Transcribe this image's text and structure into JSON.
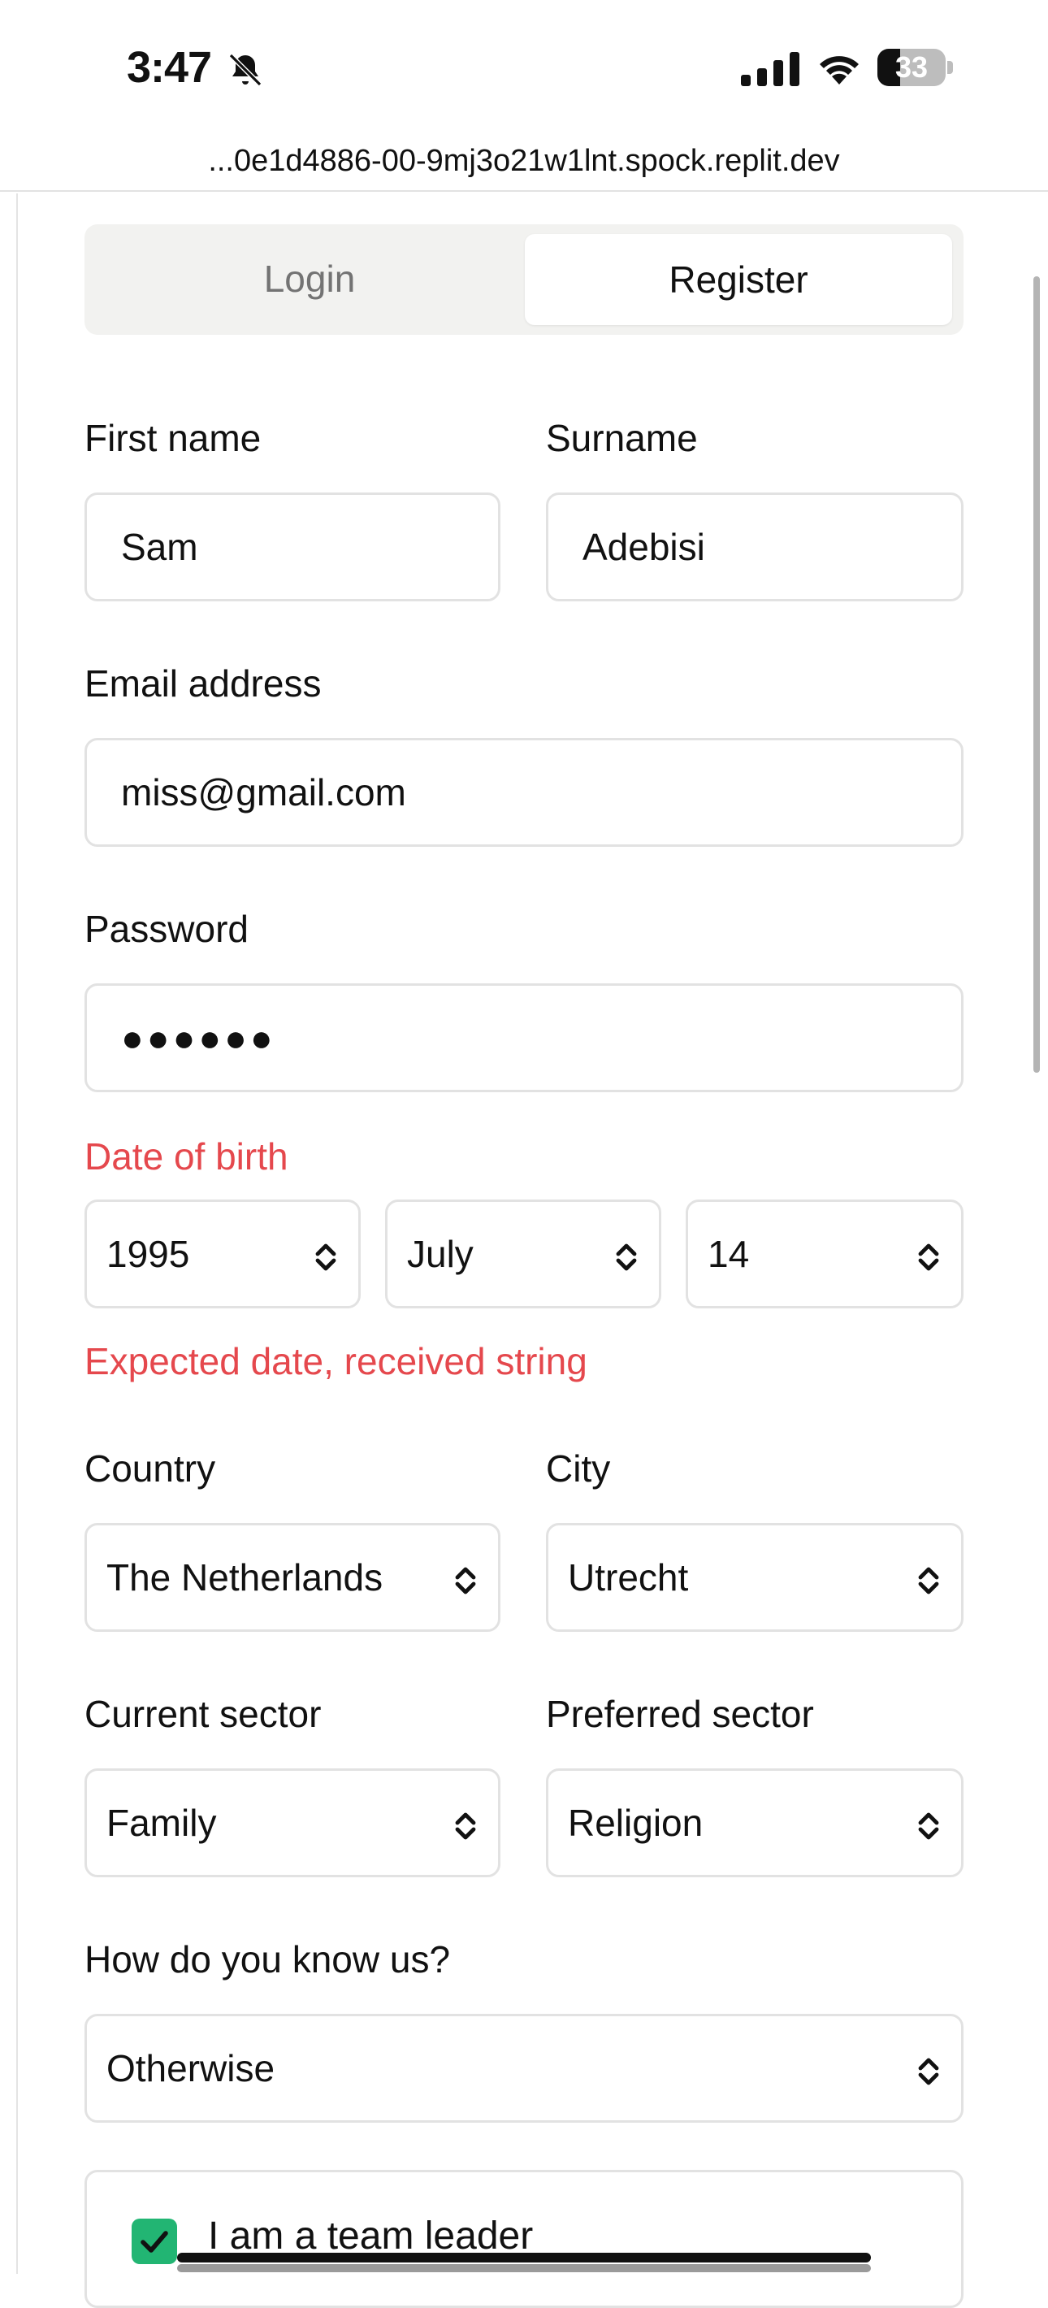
{
  "status_bar": {
    "time": "3:47",
    "battery": "33",
    "battery_level": 0.33,
    "icons": [
      "bell-slash-icon",
      "cellular-signal-icon",
      "wifi-icon",
      "battery-icon"
    ]
  },
  "browser": {
    "url": "...0e1d4886-00-9mj3o21w1lnt.spock.replit.dev"
  },
  "tabs": {
    "login": "Login",
    "register": "Register",
    "active": "register"
  },
  "form": {
    "first_name": {
      "label": "First name",
      "value": "Sam"
    },
    "surname": {
      "label": "Surname",
      "value": "Adebisi"
    },
    "email": {
      "label": "Email address",
      "value": "miss@gmail.com"
    },
    "password": {
      "label": "Password",
      "value": "●●●●●●"
    },
    "dob": {
      "label": "Date of birth",
      "year": "1995",
      "month": "July",
      "day": "14",
      "error": "Expected date, received string"
    },
    "country": {
      "label": "Country",
      "value": "The Netherlands"
    },
    "city": {
      "label": "City",
      "value": "Utrecht"
    },
    "current_sector": {
      "label": "Current sector",
      "value": "Family"
    },
    "preferred_sector": {
      "label": "Preferred sector",
      "value": "Religion"
    },
    "referral": {
      "label": "How do you know us?",
      "value": "Otherwise"
    },
    "team_leader": {
      "label": "I am a team leader",
      "checked": true
    }
  },
  "colors": {
    "error": "#e5484d",
    "checkbox": "#22b573",
    "border": "#e2e2e2"
  }
}
